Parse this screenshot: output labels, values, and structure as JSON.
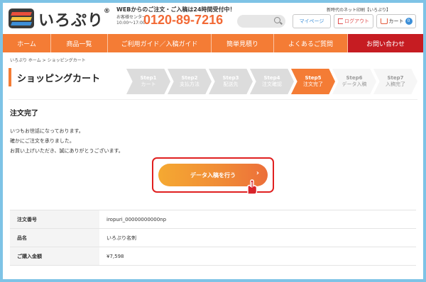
{
  "header": {
    "logo_text": "いろぷり",
    "logo_mark": "®",
    "tagline": "WEBからのご注文・ご入稿は24時間受付中！",
    "tel_caption_line1": "お客様センター",
    "tel_caption_line2": "10:00〜17:00",
    "tel": "0120-89-7216",
    "search_placeholder": "",
    "top_note": "新時代のネット印刷【いろぷり】",
    "mypage_label": "マイページ",
    "logout_label": "ログアウト",
    "cart_label": "カート",
    "cart_count": "0"
  },
  "nav": {
    "items": [
      "ホーム",
      "商品一覧",
      "ご利用ガイド／入稿ガイド",
      "簡単見積り",
      "よくあるご質問",
      "お問い合わせ"
    ]
  },
  "breadcrumb": {
    "home": "いろぷり ホーム",
    "separator": " > ",
    "current": "ショッピングカート"
  },
  "page_title": "ショッピングカート",
  "steps": [
    {
      "num": "Step1",
      "label": "カート",
      "state": "done"
    },
    {
      "num": "Step2",
      "label": "支払方法",
      "state": "done"
    },
    {
      "num": "Step3",
      "label": "配送先",
      "state": "done"
    },
    {
      "num": "Step4",
      "label": "注文確認",
      "state": "done"
    },
    {
      "num": "Step5",
      "label": "注文完了",
      "state": "active"
    },
    {
      "num": "Step6",
      "label": "データ入稿",
      "state": "future"
    },
    {
      "num": "Step7",
      "label": "入稿完了",
      "state": "future"
    }
  ],
  "section_title": "注文完了",
  "messages": [
    "いつもお世話になっております。",
    "確かにご注文を承りました。",
    "お買い上げいただき、誠にありがとうございます。"
  ],
  "cta": {
    "label": "データ入稿を行う",
    "chevron": "›"
  },
  "order_table": [
    {
      "label": "注文番号",
      "value": "iropuri_00000000000np"
    },
    {
      "label": "品名",
      "value": "いろぷり名刺"
    },
    {
      "label": "ご購入金額",
      "value": "¥7,598"
    }
  ],
  "colors": {
    "brand_orange": "#f47c35",
    "contact_red": "#c61c22",
    "highlight_red": "#e02020",
    "link_blue": "#3c8fd8"
  }
}
